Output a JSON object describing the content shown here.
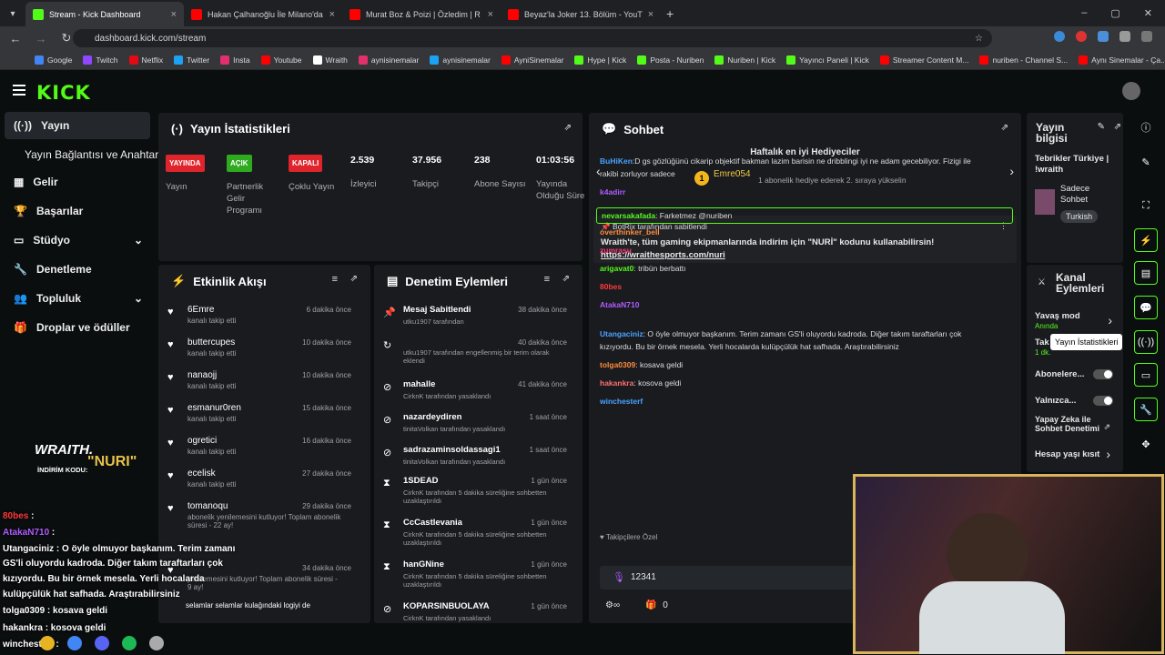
{
  "browser": {
    "tabs": [
      {
        "label": "Stream - Kick Dashboard"
      },
      {
        "label": "Hakan Çalhanoğlu İle Milano'da"
      },
      {
        "label": "Murat Boz & Poizi | Özledim | R"
      },
      {
        "label": "Beyaz'la Joker 13. Bölüm - YouT"
      }
    ],
    "url": "dashboard.kick.com/stream",
    "bookmarks": [
      "Google",
      "Twitch",
      "Netflix",
      "Twitter",
      "Insta",
      "Youtube",
      "Wraith",
      "aynisinemalar",
      "aynisinemalar",
      "AyniSinemalar",
      "Hype | Kick",
      "Posta - Nuriben",
      "Nuriben | Kick",
      "Yayıncı Paneli | Kick",
      "Streamer Content M...",
      "nuriben - Channel S...",
      "Aynı Sinemalar - Ça..."
    ]
  },
  "logo": "KICK",
  "sidebar": {
    "items": [
      {
        "label": "Yayın"
      },
      {
        "label": "Yayın Bağlantısı ve Anahtarı"
      },
      {
        "label": "Gelir"
      },
      {
        "label": "Başarılar"
      },
      {
        "label": "Stüdyo"
      },
      {
        "label": "Denetleme"
      },
      {
        "label": "Topluluk"
      },
      {
        "label": "Droplar ve ödüller"
      }
    ]
  },
  "stats": {
    "title": "Yayın İstatistikleri",
    "items": [
      {
        "badge": "YAYINDA",
        "label": "Yayın",
        "color": "#e0242b"
      },
      {
        "badge": "AÇIK",
        "label": "Partnerlik Gelir Programı",
        "color": "#2faa1f"
      },
      {
        "badge": "KAPALI",
        "label": "Çoklu Yayın",
        "color": "#e0242b"
      },
      {
        "value": "2.539",
        "label": "İzleyici"
      },
      {
        "value": "37.956",
        "label": "Takipçi"
      },
      {
        "value": "238",
        "label": "Abone Sayısı"
      },
      {
        "value": "01:03:56",
        "label": "Yayında Olduğu Süre"
      }
    ]
  },
  "activity": {
    "title": "Etkinlik Akışı",
    "events": [
      {
        "name": "6Emre",
        "sub": "kanalı takip etti",
        "time": "6 dakika önce"
      },
      {
        "name": "buttercupes",
        "sub": "kanalı takip etti",
        "time": "10 dakika önce"
      },
      {
        "name": "nanaojj",
        "sub": "kanalı takip etti",
        "time": "10 dakika önce"
      },
      {
        "name": "esmanur0ren",
        "sub": "kanalı takip etti",
        "time": "15 dakika önce"
      },
      {
        "name": "ogretici",
        "sub": "kanalı takip etti",
        "time": "16 dakika önce"
      },
      {
        "name": "ecelisk",
        "sub": "kanalı takip etti",
        "time": "27 dakika önce"
      },
      {
        "name": "tomanoqu",
        "sub": "abonelik yenilemesini kutluyor! Toplam abonelik süresi - 22 ay!",
        "time": "29 dakika önce"
      },
      {
        "name": "",
        "sub": "yenilemesini kutluyor! Toplam abonelik süresi - 9 ay!",
        "time": "34 dakika önce"
      }
    ]
  },
  "moderation": {
    "title": "Denetim Eylemleri",
    "actions": [
      {
        "name": "Mesaj Sabitlendi",
        "sub": "utku1907 tarafından",
        "time": "38 dakika önce"
      },
      {
        "name": "",
        "sub": "utku1907 tarafından engellenmiş bir terim olarak eklendi",
        "time": "40 dakika önce"
      },
      {
        "name": "mahalle",
        "sub": "CirknK tarafından yasaklandı",
        "time": "41 dakika önce"
      },
      {
        "name": "nazardeydiren",
        "sub": "tinitaVolkan tarafından yasaklandı",
        "time": "1 saat önce"
      },
      {
        "name": "sadrazaminsoldassagi1",
        "sub": "tinitaVolkan tarafından yasaklandı",
        "time": "1 saat önce"
      },
      {
        "name": "1SDEAD",
        "sub": "CirknK tarafından 5 dakika süreliğine sohbetten uzaklaştırıldı",
        "time": "1 gün önce"
      },
      {
        "name": "CcCastlevania",
        "sub": "CirknK tarafından 5 dakika süreliğine sohbetten uzaklaştırıldı",
        "time": "1 gün önce"
      },
      {
        "name": "hanGNine",
        "sub": "CirknK tarafından 5 dakika süreliğine sohbetten uzaklaştırıldı",
        "time": "1 gün önce"
      },
      {
        "name": "KOPARSINBUOLAYA",
        "sub": "CirknK tarafından yasaklandı",
        "time": "1 gün önce"
      }
    ]
  },
  "chat": {
    "title": "Sohbet",
    "gifters_title": "Haftalık en iyi Hediyeciler",
    "top_gifter": "Emre054",
    "gifter_note": "1 abonelik hediye ederek 2. sıraya yükselin",
    "pinned_by": "BotRix tarafından sabitlendi",
    "pinned_text": "Wraith'te, tüm gaming ekipmanlarında indirim için \"NURİ\" kodunu kullanabilirsin!",
    "pinned_link": "https://wraithesports.com/nuri",
    "messages": [
      {
        "user": "BuHiKen",
        "text": ":D gs gözlüğünü cikarip objektif bakman lazim barisin ne dribblingi iyi ne adam gecebiliyor. Fizigi ile"
      },
      {
        "user": "",
        "text": "rakibi zorluyor sadece"
      },
      {
        "user": "k4adirr",
        "text": ""
      },
      {
        "user": "nevarsakafada",
        "text": ": Farketmez @nuriben"
      },
      {
        "user": "overthinker_bell",
        "text": ""
      },
      {
        "user": "zumrasu",
        "text": ""
      },
      {
        "user": "arigavat0",
        "text": ": tribün berbattı"
      },
      {
        "user": "80bes",
        "text": ""
      },
      {
        "user": "AtakaN710",
        "text": ""
      },
      {
        "user": "Utangaciniz",
        "text": ": O öyle olmuyor başkanım. Terim zamanı GS'li oluyordu kadroda. Diğer takım taraftarları çok"
      },
      {
        "user": "",
        "text": "kızıyordu. Bu bir örnek mesela. Yerli hocalarda kulüpçülük hat safhada. Araştırabilirsiniz"
      },
      {
        "user": "tolga0309",
        "text": ": kosava geldi"
      },
      {
        "user": "hakankra",
        "text": ": kosova geldi"
      },
      {
        "user": "winchesterf",
        "text": ""
      }
    ],
    "followers_only": "Takipçilere Özel",
    "input_value": "12341",
    "points": "0"
  },
  "stream_info": {
    "title": "Yayın bilgisi",
    "stream_title": "Tebrikler Türkiye | !wraith",
    "category": "Sadece Sohbet",
    "language": "Turkish"
  },
  "channel_actions": {
    "title": "Kanal Eylemleri",
    "slow_mode": "Yavaş mod",
    "slow_mode_state": "Anında",
    "follower_label": "Tak",
    "follower_sub": "1 dk.",
    "sub_only": "Abonelere...",
    "emote_only": "Yalnızca...",
    "ai_mod": "Yapay Zeka ile Sohbet Denetimi",
    "age_restrict": "Hesap yaşı kısıt"
  },
  "tooltip": "Yayın İstatistikleri",
  "overlay": {
    "brand": "WRAITH.",
    "promo": "İNDİRİM KODU:",
    "code": "\"NURI\"",
    "chat": [
      {
        "user": "80bes",
        "text": " :"
      },
      {
        "user": "AtakaN710",
        "text": " :"
      },
      {
        "user": "Utangaciniz",
        "text": " : O öyle olmuyor başkanım. Terim zamanı"
      },
      {
        "user": "",
        "text": "GS'li oluyordu kadroda. Diğer takım taraftarları çok"
      },
      {
        "user": "",
        "text": "kızıyordu. Bu bir örnek mesela. Yerli hocalarda"
      },
      {
        "user": "",
        "text": "kulüpçülük hat safhada. Araştırabilirsiniz"
      },
      {
        "user": "tolga0309",
        "text": " : kosava geldi"
      },
      {
        "user": "hakankra",
        "text": " : kosova geldi"
      },
      {
        "user": "winchesterf",
        "text": " :"
      }
    ],
    "snippet": "selamlar selamlar   kulağındaki logiyi de"
  },
  "colors": {
    "accent": "#53fc18",
    "live": "#e0242b",
    "panel": "#191b1f"
  }
}
